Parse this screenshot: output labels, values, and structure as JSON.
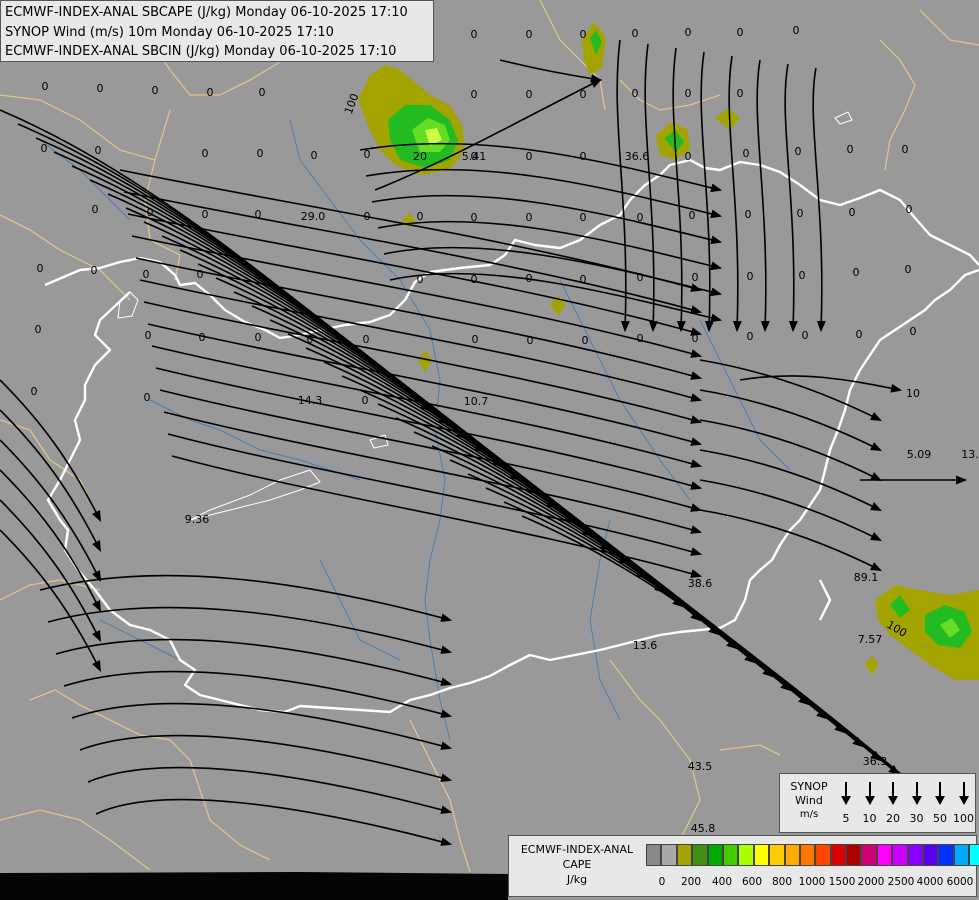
{
  "header": {
    "line1": "ECMWF-INDEX-ANAL SBCAPE (J/kg) Monday 06-10-2025 17:10",
    "line2": "SYNOP Wind (m/s) 10m Monday 06-10-2025 17:10",
    "line3": "ECMWF-INDEX-ANAL SBCIN (J/kg) Monday 06-10-2025 17:10"
  },
  "colors": {
    "background": "#999999",
    "border_national": "#ffffff",
    "border_regional": "#e0c38a",
    "rivers": "#4a7fb3",
    "streamlines": "#000000",
    "cape_low": "#a4a400",
    "cape_mid": "#22bb22",
    "cape_high": "#aaff33"
  },
  "map_labels": [
    {
      "text": "0"
    },
    {
      "text": "0"
    },
    {
      "text": "0"
    },
    {
      "text": "0"
    },
    {
      "text": "0"
    },
    {
      "text": "0"
    },
    {
      "text": "0"
    },
    {
      "text": "0"
    },
    {
      "text": "0"
    },
    {
      "text": "0"
    },
    {
      "text": "0"
    },
    {
      "text": "0"
    },
    {
      "text": "0"
    },
    {
      "text": "0"
    },
    {
      "text": "0"
    },
    {
      "text": "0"
    },
    {
      "text": "0"
    },
    {
      "text": "0"
    },
    {
      "text": "0"
    },
    {
      "text": "0"
    },
    {
      "text": "0"
    },
    {
      "text": "0"
    },
    {
      "text": "0"
    },
    {
      "text": "0"
    },
    {
      "text": "0"
    },
    {
      "text": "0"
    },
    {
      "text": "0"
    },
    {
      "text": "0"
    },
    {
      "text": "0"
    },
    {
      "text": "0"
    },
    {
      "text": "0"
    },
    {
      "text": "0"
    },
    {
      "text": "0"
    },
    {
      "text": "0"
    },
    {
      "text": "0"
    },
    {
      "text": "0"
    },
    {
      "text": "0"
    },
    {
      "text": "0"
    },
    {
      "text": "0"
    },
    {
      "text": "0"
    },
    {
      "text": "0"
    },
    {
      "text": "0"
    },
    {
      "text": "0"
    },
    {
      "text": "0"
    },
    {
      "text": "0"
    },
    {
      "text": "0"
    },
    {
      "text": "0"
    },
    {
      "text": "0"
    },
    {
      "text": "0"
    },
    {
      "text": "0"
    },
    {
      "text": "0"
    },
    {
      "text": "0"
    },
    {
      "text": "0"
    },
    {
      "text": "0"
    },
    {
      "text": "0"
    },
    {
      "text": "0"
    },
    {
      "text": "0"
    },
    {
      "text": "0"
    },
    {
      "text": "0"
    },
    {
      "text": "0"
    },
    {
      "text": "0"
    },
    {
      "text": "0"
    },
    {
      "text": "0"
    },
    {
      "text": "0"
    },
    {
      "text": "0"
    },
    {
      "text": "0"
    },
    {
      "text": "0"
    },
    {
      "text": "0"
    },
    {
      "text": "0"
    },
    {
      "text": "0"
    },
    {
      "text": "0"
    },
    {
      "text": "0"
    },
    {
      "text": "0"
    },
    {
      "text": "0"
    },
    {
      "text": "0"
    },
    {
      "text": "0"
    },
    {
      "text": "0"
    },
    {
      "text": "0"
    },
    {
      "text": "0"
    },
    {
      "text": "0"
    },
    {
      "text": "29.0"
    },
    {
      "text": "14.3"
    },
    {
      "text": "10.7"
    },
    {
      "text": "36.6"
    },
    {
      "text": "5.41"
    },
    {
      "text": "20"
    },
    {
      "text": "100"
    },
    {
      "text": "9.36"
    },
    {
      "text": "38.6"
    },
    {
      "text": "13.6"
    },
    {
      "text": "89.1"
    },
    {
      "text": "7.57"
    },
    {
      "text": "100"
    },
    {
      "text": "5.09"
    },
    {
      "text": "10"
    },
    {
      "text": "13."
    },
    {
      "text": "43.5"
    },
    {
      "text": "45.8"
    },
    {
      "text": "36.3"
    }
  ],
  "synop_legend": {
    "title_line1": "SYNOP",
    "title_line2": "Wind",
    "title_line3": "m/s",
    "values": [
      "5",
      "10",
      "20",
      "30",
      "50",
      "100"
    ]
  },
  "cape_legend": {
    "title_line1": "ECMWF-INDEX-ANAL",
    "title_line2": "CAPE",
    "title_line3": "J/kg",
    "swatch_colors": [
      "#888888",
      "#a9a9a9",
      "#a4a400",
      "#3e8e18",
      "#00aa00",
      "#44cc00",
      "#aaff00",
      "#ffff00",
      "#ffcc00",
      "#ffaa00",
      "#ff7700",
      "#ff4400",
      "#dd0000",
      "#aa0000",
      "#cc0077",
      "#ff00ff",
      "#cc00ff",
      "#8800ff",
      "#5500ee",
      "#0033ff",
      "#00aaff",
      "#00ffff",
      "#aaffff",
      "#ffffff"
    ],
    "tick_labels": [
      "0",
      "200",
      "400",
      "600",
      "800",
      "1000",
      "1500",
      "2000",
      "2500",
      "4000",
      "6000"
    ]
  }
}
